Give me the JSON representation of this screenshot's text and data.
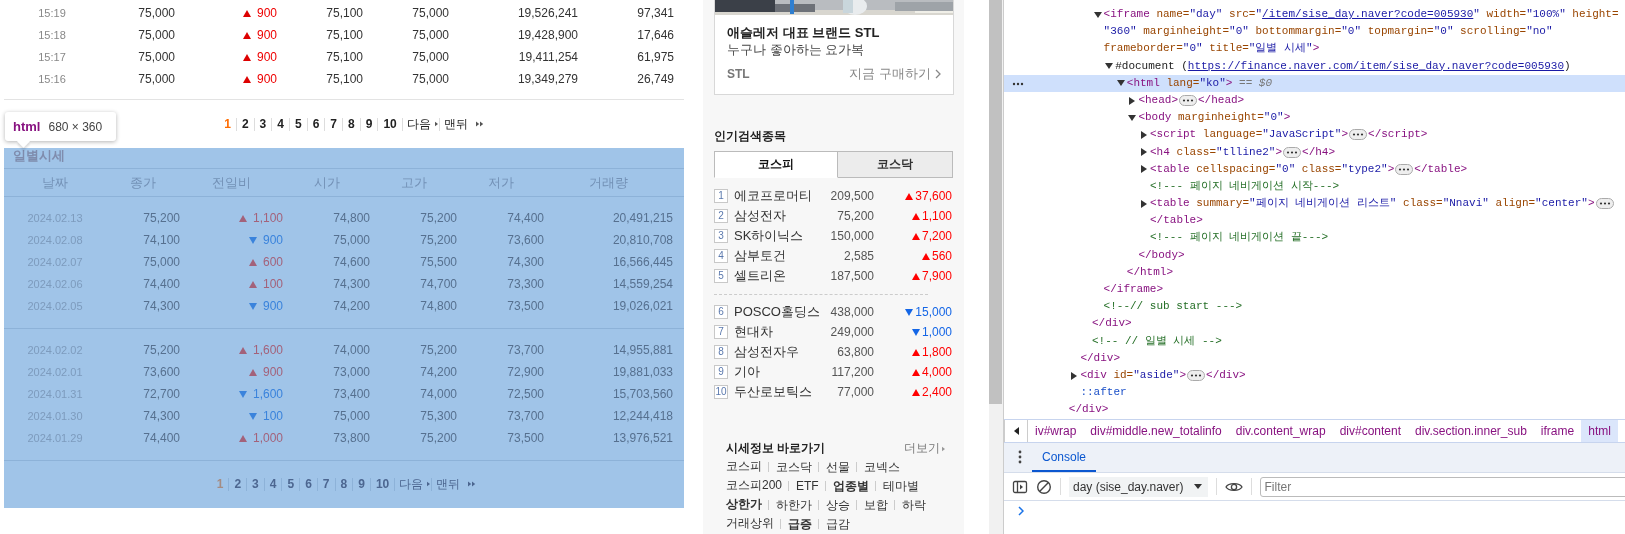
{
  "minute_table": {
    "rows": [
      {
        "time": "15:19",
        "price": "75,000",
        "rising": true,
        "change": "900",
        "sell": "75,100",
        "buy": "75,000",
        "volume": "19,526,241",
        "delta": "97,341"
      },
      {
        "time": "15:18",
        "price": "75,000",
        "rising": true,
        "change": "900",
        "sell": "75,100",
        "buy": "75,000",
        "volume": "19,428,900",
        "delta": "17,646"
      },
      {
        "time": "15:17",
        "price": "75,000",
        "rising": true,
        "change": "900",
        "sell": "75,100",
        "buy": "75,000",
        "volume": "19,411,254",
        "delta": "61,975"
      },
      {
        "time": "15:16",
        "price": "75,000",
        "rising": true,
        "change": "900",
        "sell": "75,100",
        "buy": "75,000",
        "volume": "19,349,279",
        "delta": "26,749"
      }
    ]
  },
  "minute_pagination": {
    "pages": [
      {
        "label": "1",
        "selected": true
      },
      {
        "label": "2",
        "selected": false
      },
      {
        "label": "3",
        "selected": false
      },
      {
        "label": "4",
        "selected": false
      },
      {
        "label": "5",
        "selected": false
      },
      {
        "label": "6",
        "selected": false
      },
      {
        "label": "7",
        "selected": false
      },
      {
        "label": "8",
        "selected": false
      },
      {
        "label": "9",
        "selected": false
      },
      {
        "label": "10",
        "selected": false
      }
    ],
    "next": "다음",
    "last": "맨뒤"
  },
  "inspect_tooltip": {
    "tag": "html",
    "size": "680 × 360"
  },
  "daily_frame": {
    "title": "일별시세",
    "columns": [
      "날짜",
      "종가",
      "전일비",
      "시가",
      "고가",
      "저가",
      "거래량"
    ],
    "groups": [
      [
        {
          "date": "2024.02.13",
          "close": "75,200",
          "rising": true,
          "change": "1,100",
          "open": "74,800",
          "high": "75,200",
          "low": "74,400",
          "volume": "20,491,215"
        },
        {
          "date": "2024.02.08",
          "close": "74,100",
          "rising": false,
          "change": "900",
          "open": "75,000",
          "high": "75,200",
          "low": "73,600",
          "volume": "20,810,708"
        },
        {
          "date": "2024.02.07",
          "close": "75,000",
          "rising": true,
          "change": "600",
          "open": "74,600",
          "high": "75,500",
          "low": "74,300",
          "volume": "16,566,445"
        },
        {
          "date": "2024.02.06",
          "close": "74,400",
          "rising": true,
          "change": "100",
          "open": "74,300",
          "high": "74,700",
          "low": "73,300",
          "volume": "14,559,254"
        },
        {
          "date": "2024.02.05",
          "close": "74,300",
          "rising": false,
          "change": "900",
          "open": "74,200",
          "high": "74,800",
          "low": "73,500",
          "volume": "19,026,021"
        }
      ],
      [
        {
          "date": "2024.02.02",
          "close": "75,200",
          "rising": true,
          "change": "1,600",
          "open": "74,000",
          "high": "75,200",
          "low": "73,700",
          "volume": "14,955,881"
        },
        {
          "date": "2024.02.01",
          "close": "73,600",
          "rising": true,
          "change": "900",
          "open": "73,000",
          "high": "74,200",
          "low": "72,900",
          "volume": "19,881,033"
        },
        {
          "date": "2024.01.31",
          "close": "72,700",
          "rising": false,
          "change": "1,600",
          "open": "73,400",
          "high": "74,000",
          "low": "72,500",
          "volume": "15,703,560"
        },
        {
          "date": "2024.01.30",
          "close": "74,300",
          "rising": false,
          "change": "100",
          "open": "75,000",
          "high": "75,300",
          "low": "73,700",
          "volume": "12,244,418"
        },
        {
          "date": "2024.01.29",
          "close": "74,400",
          "rising": true,
          "change": "1,000",
          "open": "73,800",
          "high": "75,200",
          "low": "73,500",
          "volume": "13,976,521"
        }
      ]
    ],
    "pagination": {
      "pages": [
        {
          "label": "1",
          "selected": true
        },
        {
          "label": "2",
          "selected": false
        },
        {
          "label": "3",
          "selected": false
        },
        {
          "label": "4",
          "selected": false
        },
        {
          "label": "5",
          "selected": false
        },
        {
          "label": "6",
          "selected": false
        },
        {
          "label": "7",
          "selected": false
        },
        {
          "label": "8",
          "selected": false
        },
        {
          "label": "9",
          "selected": false
        },
        {
          "label": "10",
          "selected": false
        }
      ],
      "next": "다음",
      "last": "맨뒤"
    }
  },
  "sidebar": {
    "ad": {
      "kind": "picture",
      "headline": "애슬레저 대표 브랜드 STL",
      "subline": "누구나 좋아하는 요가복",
      "brand": "STL",
      "cta": "지금 구매하기"
    },
    "popular": {
      "title": "인기검색종목",
      "tabs": [
        {
          "label": "코스피",
          "selected": true
        },
        {
          "label": "코스닥",
          "selected": false
        }
      ],
      "groups": [
        [
          {
            "rank": "1",
            "name": "에코프로머티",
            "price": "209,500",
            "rising": true,
            "change": "37,600"
          },
          {
            "rank": "2",
            "name": "삼성전자",
            "price": "75,200",
            "rising": true,
            "change": "1,100"
          },
          {
            "rank": "3",
            "name": "SK하이닉스",
            "price": "150,000",
            "rising": true,
            "change": "7,200"
          },
          {
            "rank": "4",
            "name": "삼부토건",
            "price": "2,585",
            "rising": true,
            "change": "560"
          },
          {
            "rank": "5",
            "name": "셀트리온",
            "price": "187,500",
            "rising": true,
            "change": "7,900"
          }
        ],
        [
          {
            "rank": "6",
            "name": "POSCO홀딩스",
            "price": "438,000",
            "rising": false,
            "change": "15,000"
          },
          {
            "rank": "7",
            "name": "현대차",
            "price": "249,000",
            "rising": false,
            "change": "1,000"
          },
          {
            "rank": "8",
            "name": "삼성전자우",
            "price": "63,800",
            "rising": true,
            "change": "1,800"
          },
          {
            "rank": "9",
            "name": "기아",
            "price": "117,200",
            "rising": true,
            "change": "4,000"
          },
          {
            "rank": "10",
            "name": "두산로보틱스",
            "price": "77,000",
            "rising": true,
            "change": "2,400"
          }
        ]
      ]
    },
    "quick_links": {
      "title": "시세정보 바로가기",
      "more": "더보기",
      "rows": [
        [
          {
            "label": "코스피",
            "bold": false
          },
          {
            "label": "코스닥",
            "bold": false
          },
          {
            "label": "선물",
            "bold": false
          },
          {
            "label": "코넥스",
            "bold": false
          }
        ],
        [
          {
            "label": "코스피200",
            "bold": false
          },
          {
            "label": "ETF",
            "bold": false
          },
          {
            "label": "업종별",
            "bold": true
          },
          {
            "label": "테마별",
            "bold": false
          }
        ],
        [
          {
            "label": "상한가",
            "bold": true
          },
          {
            "label": "하한가",
            "bold": false
          },
          {
            "label": "상승",
            "bold": false
          },
          {
            "label": "보합",
            "bold": false
          },
          {
            "label": "하락",
            "bold": false
          }
        ],
        [
          {
            "label": "거래상위",
            "bold": false
          },
          {
            "label": "급증",
            "bold": true
          },
          {
            "label": "급감",
            "bold": false
          }
        ]
      ]
    }
  },
  "devtools": {
    "tree": [
      {
        "children": [
          {
            "children": [
              {
                "children": [
                  {
                    "expanded": true,
                    "selected": false,
                    "lines": [
                      {
                        "tokens": [
                          {
                            "kind": "tag",
                            "text": "<iframe"
                          },
                          {
                            "kind": "attr",
                            "text": " name="
                          },
                          {
                            "kind": "val",
                            "text": "\"day\""
                          },
                          {
                            "kind": "attr",
                            "text": " src="
                          },
                          {
                            "kind": "val",
                            "text": "\""
                          },
                          {
                            "kind": "link",
                            "text": "/item/sise_day.naver?code=005930"
                          },
                          {
                            "kind": "val",
                            "text": "\""
                          },
                          {
                            "kind": "attr",
                            "text": " width="
                          },
                          {
                            "kind": "val",
                            "text": "\"100%\""
                          },
                          {
                            "kind": "attr",
                            "text": " height="
                          }
                        ]
                      },
                      {
                        "tokens": [
                          {
                            "kind": "val",
                            "text": "\"360\""
                          },
                          {
                            "kind": "attr",
                            "text": " marginheight="
                          },
                          {
                            "kind": "val",
                            "text": "\"0\""
                          },
                          {
                            "kind": "attr",
                            "text": " bottommargin="
                          },
                          {
                            "kind": "val",
                            "text": "\"0\""
                          },
                          {
                            "kind": "attr",
                            "text": " topmargin="
                          },
                          {
                            "kind": "val",
                            "text": "\"0\""
                          },
                          {
                            "kind": "attr",
                            "text": " scrolling="
                          },
                          {
                            "kind": "val",
                            "text": "\"no\""
                          }
                        ]
                      },
                      {
                        "tokens": [
                          {
                            "kind": "attr",
                            "text": "frameborder="
                          },
                          {
                            "kind": "val",
                            "text": "\"0\""
                          },
                          {
                            "kind": "attr",
                            "text": " title="
                          },
                          {
                            "kind": "val",
                            "text": "\"일별 시세\""
                          },
                          {
                            "kind": "tag",
                            "text": ">"
                          }
                        ]
                      }
                    ],
                    "children": [
                      {
                        "expanded": true,
                        "selected": false,
                        "lines": [
                          {
                            "tokens": [
                              {
                                "kind": "text",
                                "text": "#document ("
                              },
                              {
                                "kind": "link",
                                "text": "https://finance.naver.com/item/sise_day.naver?code=005930"
                              },
                              {
                                "kind": "text",
                                "text": ")"
                              }
                            ]
                          }
                        ],
                        "children": [
                          {
                            "expanded": true,
                            "selected": true,
                            "lines": [
                              {
                                "tokens": [
                                  {
                                    "kind": "tag",
                                    "text": "<html"
                                  },
                                  {
                                    "kind": "attr",
                                    "text": " lang="
                                  },
                                  {
                                    "kind": "val",
                                    "text": "\"ko\""
                                  },
                                  {
                                    "kind": "tag",
                                    "text": ">"
                                  },
                                  {
                                    "kind": "ref",
                                    "text": " == $0"
                                  }
                                ]
                              }
                            ],
                            "children": [
                              {
                                "expanded": false,
                                "selected": false,
                                "lines": [
                                  {
                                    "tokens": [
                                      {
                                        "kind": "tag",
                                        "text": "<head>"
                                      },
                                      {
                                        "kind": "more"
                                      },
                                      {
                                        "kind": "tag",
                                        "text": "</head>"
                                      }
                                    ]
                                  }
                                ]
                              },
                              {
                                "expanded": true,
                                "selected": false,
                                "lines": [
                                  {
                                    "tokens": [
                                      {
                                        "kind": "tag",
                                        "text": "<body"
                                      },
                                      {
                                        "kind": "attr",
                                        "text": " marginheight="
                                      },
                                      {
                                        "kind": "val",
                                        "text": "\"0\""
                                      },
                                      {
                                        "kind": "tag",
                                        "text": ">"
                                      }
                                    ]
                                  }
                                ],
                                "children": [
                                  {
                                    "expanded": false,
                                    "selected": false,
                                    "lines": [
                                      {
                                        "tokens": [
                                          {
                                            "kind": "tag",
                                            "text": "<script"
                                          },
                                          {
                                            "kind": "attr",
                                            "text": " language="
                                          },
                                          {
                                            "kind": "val",
                                            "text": "\"JavaScript\""
                                          },
                                          {
                                            "kind": "tag",
                                            "text": ">"
                                          },
                                          {
                                            "kind": "more"
                                          },
                                          {
                                            "kind": "tag",
                                            "text": "</script>"
                                          }
                                        ]
                                      }
                                    ]
                                  },
                                  {
                                    "expanded": false,
                                    "selected": false,
                                    "lines": [
                                      {
                                        "tokens": [
                                          {
                                            "kind": "tag",
                                            "text": "<h4"
                                          },
                                          {
                                            "kind": "attr",
                                            "text": " class="
                                          },
                                          {
                                            "kind": "val",
                                            "text": "\"tlline2\""
                                          },
                                          {
                                            "kind": "tag",
                                            "text": ">"
                                          },
                                          {
                                            "kind": "more"
                                          },
                                          {
                                            "kind": "tag",
                                            "text": "</h4>"
                                          }
                                        ]
                                      }
                                    ]
                                  },
                                  {
                                    "expanded": false,
                                    "selected": false,
                                    "lines": [
                                      {
                                        "tokens": [
                                          {
                                            "kind": "tag",
                                            "text": "<table"
                                          },
                                          {
                                            "kind": "attr",
                                            "text": " cellspacing="
                                          },
                                          {
                                            "kind": "val",
                                            "text": "\"0\""
                                          },
                                          {
                                            "kind": "attr",
                                            "text": " class="
                                          },
                                          {
                                            "kind": "val",
                                            "text": "\"type2\""
                                          },
                                          {
                                            "kind": "tag",
                                            "text": ">"
                                          },
                                          {
                                            "kind": "more"
                                          },
                                          {
                                            "kind": "tag",
                                            "text": "</table>"
                                          }
                                        ]
                                      }
                                    ]
                                  },
                                  {
                                    "selected": false,
                                    "lines": [
                                      {
                                        "tokens": [
                                          {
                                            "kind": "comment",
                                            "text": "<!--- 페이지 네비게이션 시작--->"
                                          }
                                        ]
                                      }
                                    ]
                                  },
                                  {
                                    "expanded": false,
                                    "selected": false,
                                    "lines": [
                                      {
                                        "tokens": [
                                          {
                                            "kind": "tag",
                                            "text": "<table"
                                          },
                                          {
                                            "kind": "attr",
                                            "text": " summary="
                                          },
                                          {
                                            "kind": "val",
                                            "text": "\"페이지 네비게이션 리스트\""
                                          },
                                          {
                                            "kind": "attr",
                                            "text": " class="
                                          },
                                          {
                                            "kind": "val",
                                            "text": "\"Nnavi\""
                                          },
                                          {
                                            "kind": "attr",
                                            "text": " align="
                                          },
                                          {
                                            "kind": "val",
                                            "text": "\"center\""
                                          },
                                          {
                                            "kind": "tag",
                                            "text": ">"
                                          },
                                          {
                                            "kind": "more"
                                          }
                                        ]
                                      },
                                      {
                                        "tokens": [
                                          {
                                            "kind": "tag",
                                            "text": "</table>"
                                          }
                                        ]
                                      }
                                    ]
                                  },
                                  {
                                    "selected": false,
                                    "lines": [
                                      {
                                        "tokens": [
                                          {
                                            "kind": "comment",
                                            "text": "<!--- 페이지 네비게이션 끝--->"
                                          }
                                        ]
                                      }
                                    ]
                                  }
                                ],
                                "closing": {
                                  "tokens": [
                                    {
                                      "kind": "tag",
                                      "text": "</body>"
                                    }
                                  ]
                                }
                              }
                            ],
                            "closing": {
                              "tokens": [
                                {
                                  "kind": "tag",
                                  "text": "</html>"
                                }
                              ]
                            }
                          }
                        ]
                      }
                    ],
                    "closing": {
                      "tokens": [
                        {
                          "kind": "tag",
                          "text": "</iframe>"
                        }
                      ]
                    }
                  },
                  {
                    "selected": false,
                    "lines": [
                      {
                        "tokens": [
                          {
                            "kind": "comment",
                            "text": "<!--// sub start --->"
                          }
                        ]
                      }
                    ]
                  }
                ],
                "closing": {
                  "tokens": [
                    {
                      "kind": "tag",
                      "text": "</div>"
                    }
                  ]
                }
              },
              {
                "selected": false,
                "lines": [
                  {
                    "tokens": [
                      {
                        "kind": "comment",
                        "text": "<!-- // 일별 시세 -->"
                      }
                    ]
                  }
                ]
              }
            ],
            "closing": {
              "tokens": [
                {
                  "kind": "tag",
                  "text": "</div>"
                }
              ]
            }
          },
          {
            "expanded": false,
            "selected": false,
            "lines": [
              {
                "tokens": [
                  {
                    "kind": "tag",
                    "text": "<div"
                  },
                  {
                    "kind": "attr",
                    "text": " id="
                  },
                  {
                    "kind": "val",
                    "text": "\"aside\""
                  },
                  {
                    "kind": "tag",
                    "text": ">"
                  },
                  {
                    "kind": "more"
                  },
                  {
                    "kind": "tag",
                    "text": "</div>"
                  }
                ]
              }
            ]
          },
          {
            "selected": false,
            "lines": [
              {
                "tokens": [
                  {
                    "kind": "pseudo",
                    "text": "::after"
                  }
                ]
              }
            ]
          }
        ],
        "closing": {
          "tokens": [
            {
              "kind": "tag",
              "text": "</div>"
            }
          ]
        }
      }
    ],
    "breadcrumbs": [
      {
        "label": "iv#wrap",
        "selected": false
      },
      {
        "label": "div#middle.new_totalinfo",
        "selected": false
      },
      {
        "label": "div.content_wrap",
        "selected": false
      },
      {
        "label": "div#content",
        "selected": false
      },
      {
        "label": "div.section.inner_sub",
        "selected": false
      },
      {
        "label": "iframe",
        "selected": false
      },
      {
        "label": "html",
        "selected": true
      }
    ],
    "drawer_tabs": [
      {
        "label": "Console",
        "selected": true
      }
    ],
    "context": "day (sise_day.naver)",
    "filter_placeholder": "Filter"
  }
}
